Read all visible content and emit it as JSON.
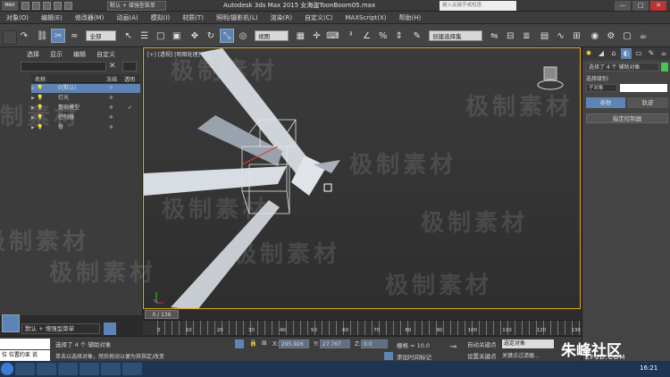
{
  "titlebar": {
    "logo": "MAX",
    "workspace": "默认 + 增强型菜单",
    "title": "Autodesk 3ds Max  2015     女海盗ToonBoom05.max",
    "search_placeholder": "键入关键字或短语",
    "min": "—",
    "max": "□",
    "close": "✕"
  },
  "menu": [
    "对象(O)",
    "编辑(E)",
    "修改器(M)",
    "动画(A)",
    "模拟(I)",
    "材质(T)",
    "照明/摄影机(L)",
    "渲染(R)",
    "自定义(C)",
    "MAXScript(X)",
    "帮助(H)"
  ],
  "toolbar": {
    "selection_filter": "全部",
    "view_combo": "视图",
    "named_set": "创建选择集"
  },
  "scene_explorer": {
    "menu": [
      "选择",
      "显示",
      "编辑",
      "自定义"
    ],
    "columns": {
      "name": "名称",
      "freeze": "冻结",
      "transparent": "透明"
    },
    "rows": [
      {
        "name": "0(默认)",
        "highlight": true,
        "check": ""
      },
      {
        "name": "灯光",
        "highlight": false,
        "check": ""
      },
      {
        "name": "基础模型",
        "highlight": false,
        "check": "✓"
      },
      {
        "name": "控制器",
        "highlight": false,
        "check": ""
      },
      {
        "name": "骨",
        "highlight": false,
        "check": ""
      }
    ],
    "layer_combo": "默认 + 增强型菜单"
  },
  "viewport": {
    "label": "[+] [透视] [明暗处理]",
    "watermark": "极制素材"
  },
  "command_panel": {
    "selection_text": "选择了 4 个 辅助对象",
    "selection_set_label": "选择级别:",
    "subobject": "子对象",
    "mode_buttons": [
      "参数",
      "轨迹"
    ],
    "rollout": "指定控制器"
  },
  "timeline": {
    "slider_label": "0 / 136",
    "ticks": [
      "0",
      "10",
      "20",
      "30",
      "40",
      "50",
      "60",
      "70",
      "80",
      "90",
      "100",
      "110",
      "120",
      "130"
    ]
  },
  "status": {
    "line1": "选择了 4 个 辅助对象",
    "line2": "单击以选择对象，然后拖动以便为其指定/改变",
    "x_label": "X:",
    "x_value": "295.926",
    "y_label": "Y:",
    "y_value": "27.767",
    "z_label": "Z:",
    "z_value": "0.0",
    "grid": "栅格 = 10.0",
    "autokey": "自动关键点",
    "setkey": "设置关键点",
    "selected_obj": "选定对象",
    "keyfilter": "关键点过滤器...",
    "add_time_tag": "添加时间标记",
    "coord_label": "位 位置约束 说"
  },
  "taskbar": {
    "clock": "16:21",
    "brand": "朱峰社区",
    "brand_sub": "ZF3D.COM"
  },
  "colors": {
    "accent": "#5d84b5",
    "viewport_border": "#e0a81c"
  }
}
